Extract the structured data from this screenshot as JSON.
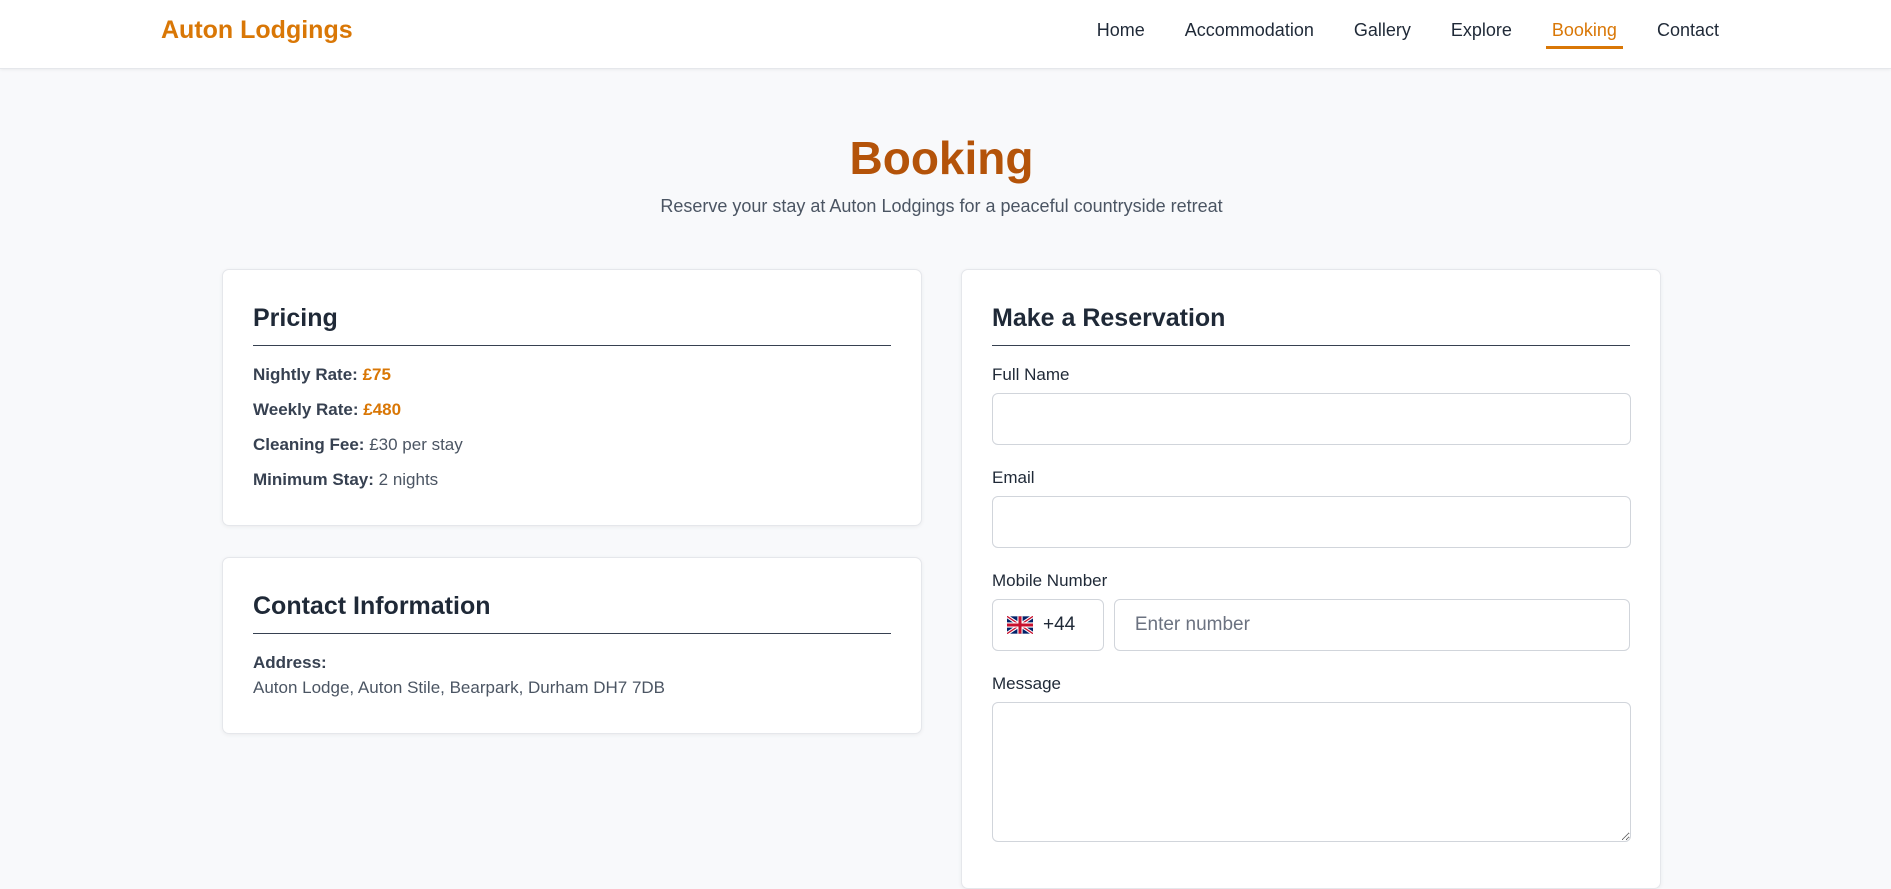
{
  "header": {
    "brand": "Auton Lodgings",
    "nav": [
      {
        "label": "Home",
        "active": false
      },
      {
        "label": "Accommodation",
        "active": false
      },
      {
        "label": "Gallery",
        "active": false
      },
      {
        "label": "Explore",
        "active": false
      },
      {
        "label": "Booking",
        "active": true
      },
      {
        "label": "Contact",
        "active": false
      }
    ]
  },
  "hero": {
    "title": "Booking",
    "subtitle": "Reserve your stay at Auton Lodgings for a peaceful countryside retreat"
  },
  "pricing": {
    "title": "Pricing",
    "rows": [
      {
        "label": "Nightly Rate:",
        "value": "£75",
        "accent": true
      },
      {
        "label": "Weekly Rate:",
        "value": "£480",
        "accent": true
      },
      {
        "label": "Cleaning Fee:",
        "value": "£30 per stay",
        "accent": false
      },
      {
        "label": "Minimum Stay:",
        "value": "2 nights",
        "accent": false
      }
    ]
  },
  "contact": {
    "title": "Contact Information",
    "address_label": "Address:",
    "address_value": "Auton Lodge, Auton Stile, Bearpark, Durham DH7 7DB"
  },
  "reservation": {
    "title": "Make a Reservation",
    "full_name_label": "Full Name",
    "full_name_value": "",
    "email_label": "Email",
    "email_value": "",
    "mobile_label": "Mobile Number",
    "country_flag_icon": "uk-flag-icon",
    "country_code": "+44",
    "mobile_placeholder": "Enter number",
    "mobile_value": "",
    "message_label": "Message",
    "message_value": ""
  },
  "colors": {
    "accent": "#d97706",
    "title": "#b45309",
    "background": "#f8f9fb"
  }
}
